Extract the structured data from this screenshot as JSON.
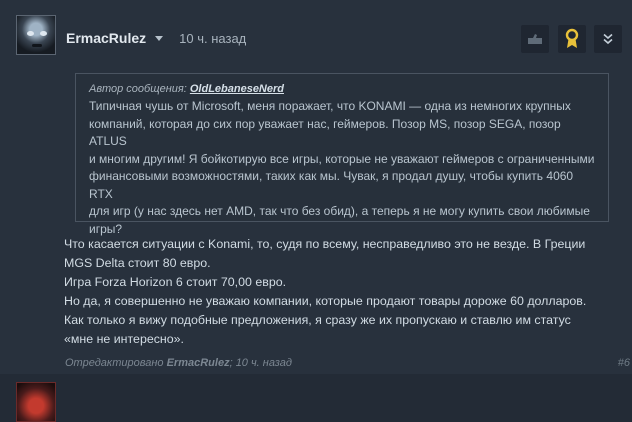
{
  "post": {
    "author": "ErmacRulez",
    "timestamp": "10 ч. назад",
    "quote": {
      "prefix": "Автор сообщения:",
      "author": "OldLebaneseNerd",
      "lines": [
        "Типичная чушь от Microsoft, меня поражает, что KONAMI — одна из немногих крупных",
        "компаний, которая до сих пор уважает нас, геймеров. Позор MS, позор SEGA, позор ATLUS",
        "и многим другим! Я бойкотирую все игры, которые не уважают геймеров с ограниченными",
        "финансовыми возможностями, таких как мы. Чувак, я продал душу, чтобы купить 4060 RTX",
        "для игр (у нас здесь нет AMD, так что без обид), а теперь я не могу купить свои любимые",
        "игры?"
      ]
    },
    "body_lines": [
      "Что касается ситуации с Konami, то, судя по всему, несправедливо это не везде. В Греции",
      "MGS Delta стоит 80 евро.",
      "Игра Forza Horizon 6 стоит 70,00 евро.",
      "Но да, я совершенно не уважаю компании, которые продают товары дороже 60 долларов.",
      "Как только я вижу подобные предложения, я сразу же их пропускаю и ставлю им статус",
      "«мне не интересно»."
    ],
    "edited": {
      "prefix": "Отредактировано",
      "editor": "ErmacRulez",
      "suffix": "; 10 ч. назад"
    },
    "post_number": "#6"
  },
  "icons": {
    "vote": "thumbs-icon",
    "award": "award-ribbon-icon",
    "more": "double-chevron-down-icon",
    "author_menu": "caret-down-icon"
  },
  "colors": {
    "background": "#28313d",
    "award": "#e8c13a",
    "author": "#e2e8ee"
  }
}
